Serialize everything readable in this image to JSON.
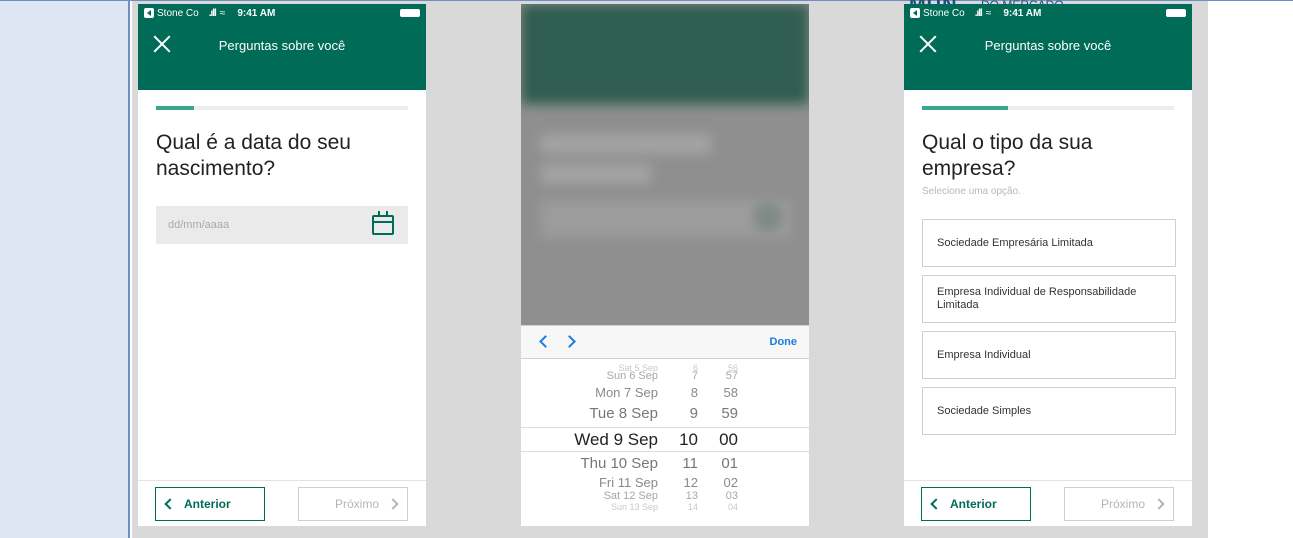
{
  "status_bar": {
    "carrier": "Stone Co",
    "signal": ".ıll",
    "time": "9:41 AM"
  },
  "logo": {
    "mark": "MUN",
    "text": "DO MERCADO FINANCEIRO"
  },
  "screen1": {
    "header_title": "Perguntas sobre você",
    "progress": 0.15,
    "question": "Qual é a data do seu nascimento?",
    "date_placeholder": "dd/mm/aaaa",
    "prev_label": "Anterior",
    "next_label": "Próximo"
  },
  "screen2": {
    "done_label": "Done",
    "picker_rows": [
      {
        "day": "Sat 5 Sep",
        "hour": "6",
        "minute": "56"
      },
      {
        "day": "Sun 6 Sep",
        "hour": "7",
        "minute": "57"
      },
      {
        "day": "Mon 7 Sep",
        "hour": "8",
        "minute": "58"
      },
      {
        "day": "Tue 8 Sep",
        "hour": "9",
        "minute": "59"
      },
      {
        "day": "Wed 9 Sep",
        "hour": "10",
        "minute": "00"
      },
      {
        "day": "Thu 10 Sep",
        "hour": "11",
        "minute": "01"
      },
      {
        "day": "Fri 11 Sep",
        "hour": "12",
        "minute": "02"
      },
      {
        "day": "Sat 12 Sep",
        "hour": "13",
        "minute": "03"
      },
      {
        "day": "Sun 13 Sep",
        "hour": "14",
        "minute": "04"
      }
    ]
  },
  "screen3": {
    "header_title": "Perguntas sobre você",
    "progress": 0.34,
    "question": "Qual o tipo da sua empresa?",
    "hint": "Selecione uma opção.",
    "options": [
      "Sociedade Empresária Limitada",
      "Empresa Individual de Responsabilidade Limitada",
      "Empresa Individual",
      "Sociedade Simples"
    ],
    "prev_label": "Anterior",
    "next_label": "Próximo"
  },
  "colors": {
    "brand_green": "#006b56",
    "progress_green": "#37a693",
    "ios_blue": "#1a7ce0",
    "background_gray": "#d9d9d9",
    "side_panel": "#dfe6f3"
  }
}
